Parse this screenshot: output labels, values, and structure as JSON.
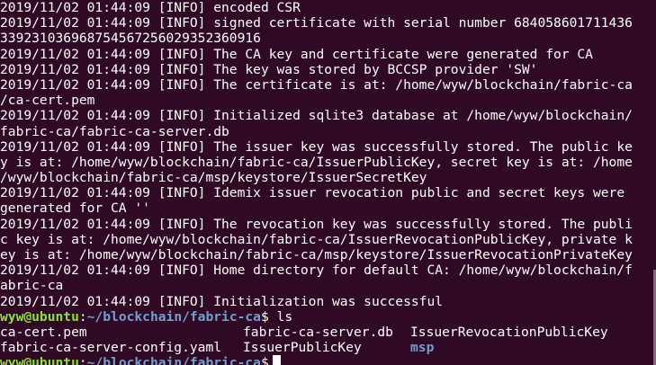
{
  "log_lines": [
    "2019/11/02 01:44:09 [INFO] encoded CSR",
    "2019/11/02 01:44:09 [INFO] signed certificate with serial number 684058601711436",
    "339231036968754567256029352360916",
    "2019/11/02 01:44:09 [INFO] The CA key and certificate were generated for CA",
    "2019/11/02 01:44:09 [INFO] The key was stored by BCCSP provider 'SW'",
    "2019/11/02 01:44:09 [INFO] The certificate is at: /home/wyw/blockchain/fabric-ca",
    "/ca-cert.pem",
    "2019/11/02 01:44:09 [INFO] Initialized sqlite3 database at /home/wyw/blockchain/",
    "fabric-ca/fabric-ca-server.db",
    "2019/11/02 01:44:09 [INFO] The issuer key was successfully stored. The public ke",
    "y is at: /home/wyw/blockchain/fabric-ca/IssuerPublicKey, secret key is at: /home",
    "/wyw/blockchain/fabric-ca/msp/keystore/IssuerSecretKey",
    "2019/11/02 01:44:09 [INFO] Idemix issuer revocation public and secret keys were",
    "generated for CA ''",
    "2019/11/02 01:44:09 [INFO] The revocation key was successfully stored. The publi",
    "c key is at: /home/wyw/blockchain/fabric-ca/IssuerRevocationPublicKey, private k",
    "ey is at: /home/wyw/blockchain/fabric-ca/msp/keystore/IssuerRevocationPrivateKey",
    "2019/11/02 01:44:09 [INFO] Home directory for default CA: /home/wyw/blockchain/f",
    "abric-ca",
    "2019/11/02 01:44:09 [INFO] Initialization was successful"
  ],
  "prompt": {
    "user_host": "wyw@ubuntu",
    "colon": ":",
    "path": "~/blockchain/fabric-ca",
    "dollar": "$",
    "command": " ls"
  },
  "ls_output": {
    "row1": [
      "ca-cert.pem",
      "fabric-ca-server.db",
      "IssuerRevocationPublicKey"
    ],
    "row2": [
      "fabric-ca-server-config.yaml",
      "IssuerPublicKey",
      "msp"
    ]
  },
  "colors": {
    "background": "#300a24",
    "text": "#ffffff",
    "user_host": "#8ae234",
    "path": "#729fcf",
    "directory": "#729fcf"
  }
}
